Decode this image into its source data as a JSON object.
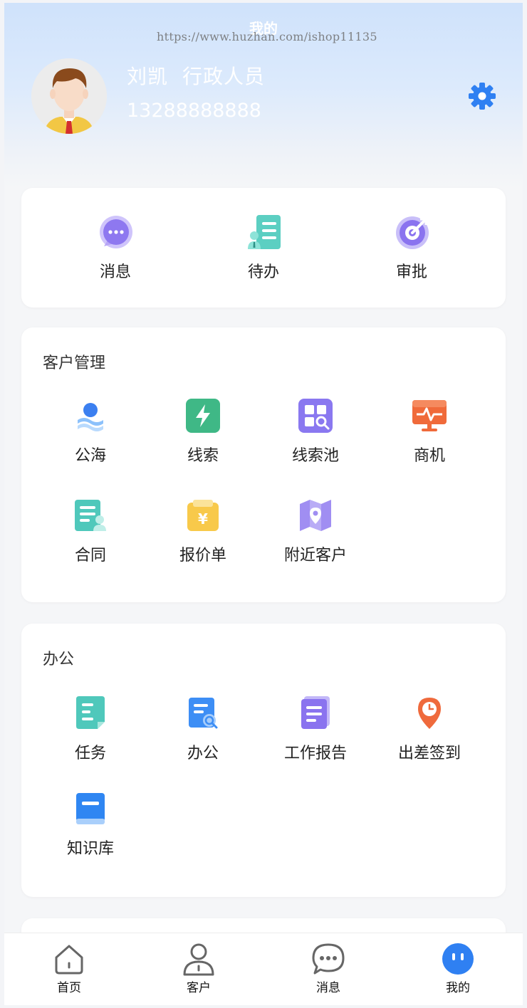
{
  "header": {
    "title": "我的",
    "watermark": "https://www.huzhan.com/ishop11135"
  },
  "user": {
    "name": "刘凯",
    "role": "行政人员",
    "phone": "13288888888"
  },
  "quick_actions": [
    {
      "label": "消息",
      "icon": "message-bubble-icon"
    },
    {
      "label": "待办",
      "icon": "todo-list-icon"
    },
    {
      "label": "审批",
      "icon": "approval-target-icon"
    }
  ],
  "customer_section": {
    "title": "客户管理",
    "items": [
      {
        "label": "公海",
        "icon": "public-sea-icon"
      },
      {
        "label": "线索",
        "icon": "lead-lightning-icon"
      },
      {
        "label": "线索池",
        "icon": "lead-pool-icon"
      },
      {
        "label": "商机",
        "icon": "opportunity-monitor-icon"
      },
      {
        "label": "合同",
        "icon": "contract-icon"
      },
      {
        "label": "报价单",
        "icon": "quotation-yuan-icon"
      },
      {
        "label": "附近客户",
        "icon": "nearby-map-icon"
      }
    ]
  },
  "office_section": {
    "title": "办公",
    "items": [
      {
        "label": "任务",
        "icon": "task-icon"
      },
      {
        "label": "办公",
        "icon": "office-search-icon"
      },
      {
        "label": "工作报告",
        "icon": "work-report-icon"
      },
      {
        "label": "出差签到",
        "icon": "checkin-location-icon"
      },
      {
        "label": "知识库",
        "icon": "knowledge-book-icon"
      }
    ]
  },
  "tabbar": {
    "items": [
      {
        "label": "首页",
        "icon": "home-icon",
        "active": false
      },
      {
        "label": "客户",
        "icon": "customer-icon",
        "active": false
      },
      {
        "label": "消息",
        "icon": "chat-icon",
        "active": false
      },
      {
        "label": "我的",
        "icon": "profile-icon",
        "active": true
      }
    ]
  },
  "colors": {
    "accent": "#2f80f2",
    "header_gradient_top": "#cfe2fb",
    "settings_icon": "#2f80f2"
  }
}
